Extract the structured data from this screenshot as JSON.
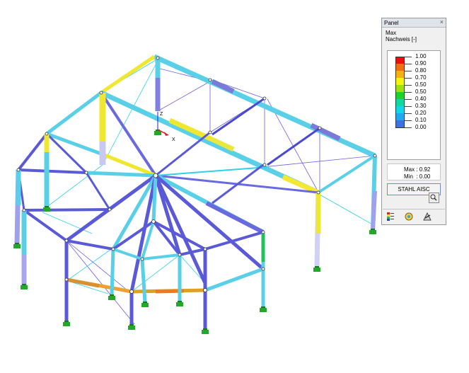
{
  "panel": {
    "title": "Panel",
    "close_glyph": "×",
    "header_line1": "Max",
    "header_line2": "Nachweis [-]",
    "legend": [
      {
        "value": "1.00",
        "color": "#e81010"
      },
      {
        "value": "0.90",
        "color": "#f07010"
      },
      {
        "value": "0.80",
        "color": "#f4b010"
      },
      {
        "value": "0.70",
        "color": "#f4f410"
      },
      {
        "value": "0.50",
        "color": "#a0e010"
      },
      {
        "value": "0.50",
        "color": "#20d030"
      },
      {
        "value": "0.40",
        "color": "#10d8a0"
      },
      {
        "value": "0.30",
        "color": "#10d8e8"
      },
      {
        "value": "0.20",
        "color": "#20a8f0"
      },
      {
        "value": "0.10",
        "color": "#4070e0"
      },
      {
        "value": "0.00",
        "color": "#5050c8"
      }
    ],
    "max_label": "Max",
    "max_value": "0.92",
    "min_label": "Min",
    "min_value": "0.00",
    "module_button": "STAHL AISC",
    "icons": {
      "zoom": "zoom-to-icon",
      "colorscale": "color-scale-icon",
      "balance": "balance-icon",
      "settings": "settings-icon"
    }
  },
  "axes": {
    "x_label": "X",
    "z_label": "Z"
  }
}
